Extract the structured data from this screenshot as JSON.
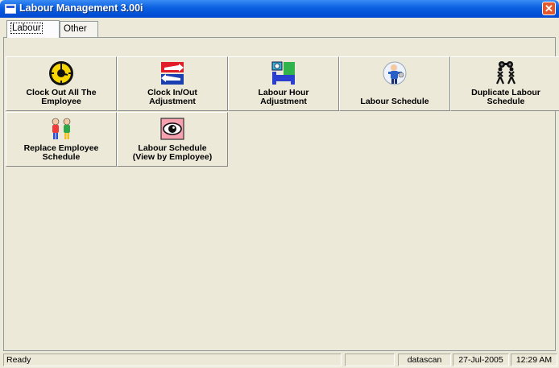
{
  "window": {
    "title": "Labour Management 3.00i",
    "close_symbol": "✕"
  },
  "tabs": [
    {
      "label": "Labour",
      "active": true
    },
    {
      "label": "Other",
      "active": false
    }
  ],
  "tiles": [
    {
      "label_line1": "Clock Out All The",
      "label_line2": "Employee",
      "icon": "clock-icon"
    },
    {
      "label_line1": "Clock In/Out",
      "label_line2": "Adjustment",
      "icon": "flag-arrows-icon"
    },
    {
      "label_line1": "Labour Hour",
      "label_line2": "Adjustment",
      "icon": "time-bed-icon"
    },
    {
      "label_line1": "Labour Schedule",
      "label_line2": "",
      "icon": "worker-icon"
    },
    {
      "label_line1": "Duplicate Labour",
      "label_line2": "Schedule",
      "icon": "binoculars-people-icon"
    },
    {
      "label_line1": "Replace Employee",
      "label_line2": "Schedule",
      "icon": "two-people-icon"
    },
    {
      "label_line1": "Labour Schedule",
      "label_line2": "(View by Employee)",
      "icon": "eye-icon"
    }
  ],
  "statusbar": {
    "status": "Ready",
    "user": "datascan",
    "date": "27-Jul-2005",
    "time": "12:29 AM"
  },
  "colors": {
    "titlebar": "#0a5fe0",
    "close": "#e4582e",
    "panel": "#ece9d8"
  }
}
